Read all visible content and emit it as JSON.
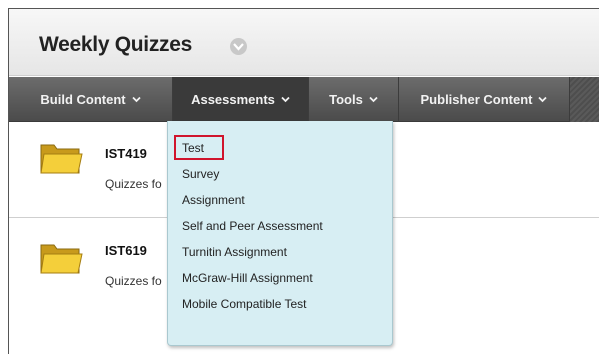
{
  "page": {
    "title": "Weekly Quizzes"
  },
  "nav": {
    "tabs": [
      {
        "label": "Build Content"
      },
      {
        "label": "Assessments"
      },
      {
        "label": "Tools"
      },
      {
        "label": "Publisher Content"
      }
    ]
  },
  "content": {
    "items": [
      {
        "title": "IST419",
        "description": "Quizzes fo"
      },
      {
        "title": "IST619",
        "description": "Quizzes fo"
      }
    ]
  },
  "assessments_menu": {
    "items": [
      {
        "label": "Test"
      },
      {
        "label": "Survey"
      },
      {
        "label": "Assignment"
      },
      {
        "label": "Self and Peer Assessment"
      },
      {
        "label": "Turnitin Assignment"
      },
      {
        "label": "McGraw-Hill Assignment"
      },
      {
        "label": "Mobile Compatible Test"
      }
    ]
  },
  "icons": {
    "title_menu": "chevron-down-icon",
    "folder": "folder-icon"
  },
  "colors": {
    "navbar": "#555555",
    "menu_background": "#d7eef3",
    "highlight": "#d0142c"
  }
}
